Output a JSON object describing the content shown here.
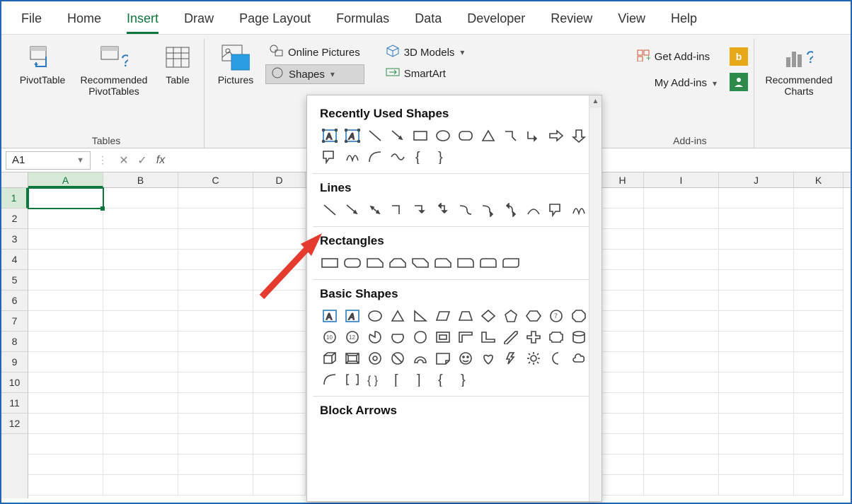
{
  "tabs": {
    "file": "File",
    "home": "Home",
    "insert": "Insert",
    "draw": "Draw",
    "page_layout": "Page Layout",
    "formulas": "Formulas",
    "data": "Data",
    "developer": "Developer",
    "review": "Review",
    "view": "View",
    "help": "Help",
    "active": "insert"
  },
  "ribbon": {
    "tables": {
      "pivot": "PivotTable",
      "recpivot": "Recommended PivotTables",
      "table": "Table",
      "group": "Tables"
    },
    "illustrations": {
      "pictures": "Pictures",
      "online_pictures": "Online Pictures",
      "shapes": "Shapes",
      "models": "3D Models",
      "smartart": "SmartArt"
    },
    "addins": {
      "get": "Get Add-ins",
      "my": "My Add-ins",
      "group": "Add-ins"
    },
    "charts": {
      "rec": "Recommended Charts"
    }
  },
  "namebox": {
    "value": "A1"
  },
  "columns": [
    "A",
    "B",
    "C",
    "D",
    "H",
    "I",
    "J",
    "K"
  ],
  "rows": [
    "1",
    "2",
    "3",
    "4",
    "5",
    "6",
    "7",
    "8",
    "9",
    "10",
    "11",
    "12"
  ],
  "shapes_panel": {
    "recent": "Recently Used Shapes",
    "lines": "Lines",
    "rects": "Rectangles",
    "basic": "Basic Shapes",
    "block": "Block Arrows"
  }
}
